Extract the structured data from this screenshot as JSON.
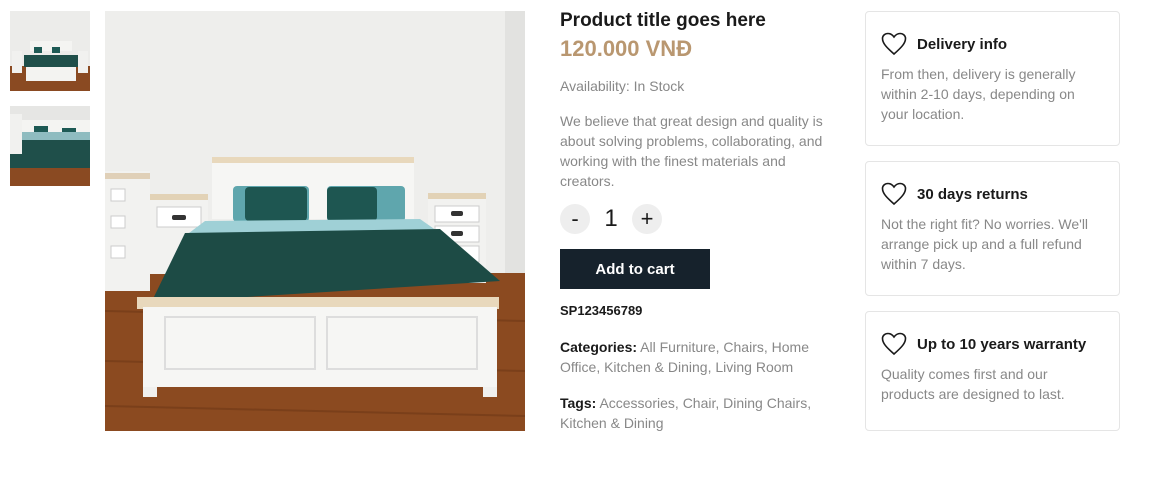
{
  "gallery": {
    "thumbnails": [
      {
        "alt": "bedroom-thumbnail-1"
      },
      {
        "alt": "bedroom-thumbnail-2"
      }
    ],
    "main_image": {
      "alt": "bedroom-main-image"
    }
  },
  "product": {
    "title": "Product title goes here",
    "price": "120.000 VNĐ",
    "availability": "Availability: In Stock",
    "description": "We believe that great design and quality is about solving problems, collaborating, and working with the finest materials and creators.",
    "quantity": {
      "minus_label": "-",
      "value": "1",
      "plus_label": "+"
    },
    "add_to_cart_label": "Add to cart",
    "sku": "SP123456789",
    "categories_label": "Categories:",
    "categories": [
      "All Furniture",
      "Chairs",
      "Home Office",
      "Kitchen & Dining",
      "Living Room"
    ],
    "tags_label": "Tags:",
    "tags": [
      "Accessories",
      "Chair",
      "Dining Chairs",
      "Kitchen & Dining"
    ]
  },
  "features": [
    {
      "icon": "heart-icon",
      "title": "Delivery info",
      "text": "From then, delivery is generally within 2-10 days, depending on your location."
    },
    {
      "icon": "heart-icon",
      "title": "30 days returns",
      "text": "Not the right fit? No worries. We'll arrange pick up and a full refund within 7 days."
    },
    {
      "icon": "heart-icon",
      "title": "Up to 10 years warranty",
      "text": "Quality comes first and our products are designed to last."
    }
  ],
  "colors": {
    "accent_price": "#b99770",
    "button_bg": "#16222c",
    "muted_text": "#888888"
  }
}
